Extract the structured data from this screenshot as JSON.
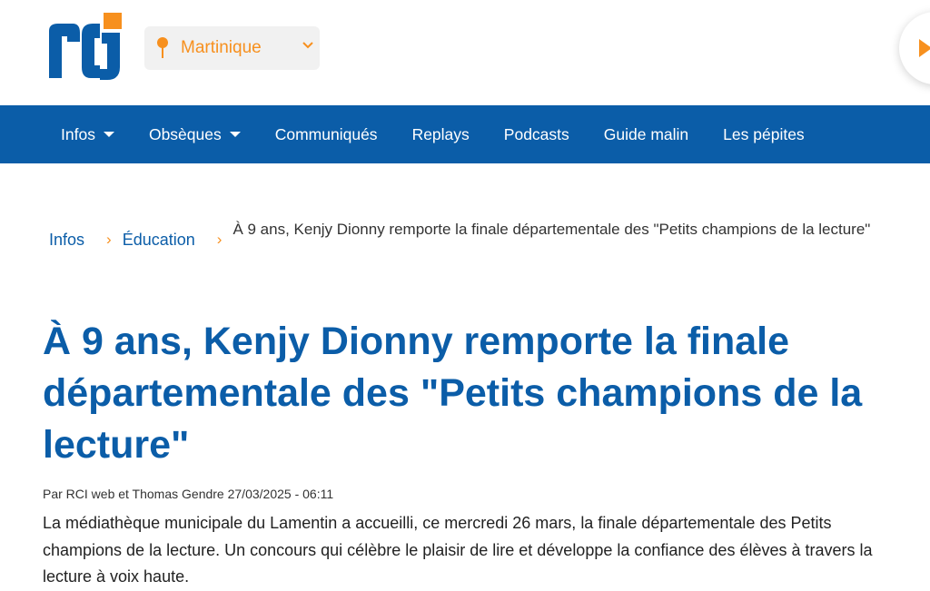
{
  "header": {
    "logo_text": "rci",
    "region_label": "Martinique"
  },
  "colors": {
    "brand_blue": "#0b5da8",
    "accent_orange": "#f7901e"
  },
  "nav": {
    "items": [
      {
        "label": "Infos",
        "dropdown": true
      },
      {
        "label": "Obsèques",
        "dropdown": true
      },
      {
        "label": "Communiqués",
        "dropdown": false
      },
      {
        "label": "Replays",
        "dropdown": false
      },
      {
        "label": "Podcasts",
        "dropdown": false
      },
      {
        "label": "Guide malin",
        "dropdown": false
      },
      {
        "label": "Les pépites",
        "dropdown": false
      }
    ]
  },
  "breadcrumb": {
    "items": [
      "Infos",
      "Éducation"
    ],
    "separator": "›",
    "current": "À 9 ans, Kenjy Dionny remporte la finale départementale des \"Petits champions de la lecture\""
  },
  "article": {
    "title": "À 9 ans, Kenjy Dionny remporte la finale départementale des \"Petits champions de la lecture\"",
    "meta": "Par RCI web et Thomas Gendre 27/03/2025 - 06:11",
    "lead": "La médiathèque municipale du Lamentin a accueilli, ce mercredi 26 mars, la finale départementale des Petits champions de la lecture. Un concours qui célèbre le plaisir de lire et développe la confiance des élèves à travers la lecture à voix haute."
  }
}
